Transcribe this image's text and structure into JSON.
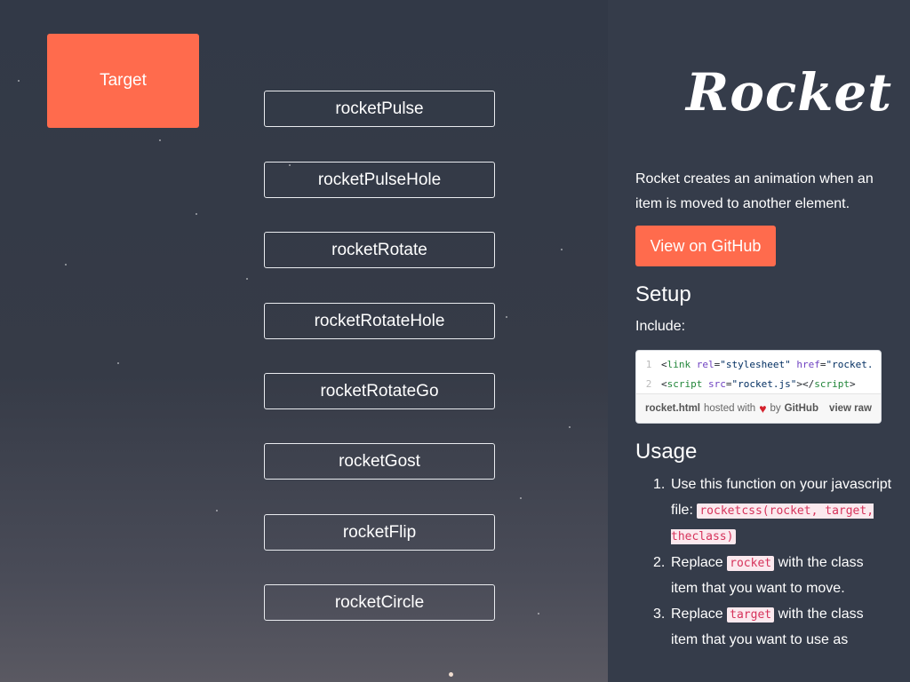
{
  "target": {
    "label": "Target"
  },
  "rocket_buttons": [
    "rocketPulse",
    "rocketPulseHole",
    "rocketRotate",
    "rocketRotateHole",
    "rocketRotateGo",
    "rocketGost",
    "rocketFlip",
    "rocketCircle"
  ],
  "sidebar": {
    "logo": "Rocket",
    "intro": "Rocket creates an animation when an item is moved to another element.",
    "github_button": "View on GitHub",
    "setup_heading": "Setup",
    "include_label": "Include:",
    "gist": {
      "line_numbers": [
        "1",
        "2"
      ],
      "file_name": "rocket.html",
      "hosted_with": "hosted with",
      "by_text": "by",
      "github": "GitHub",
      "view_raw": "view raw"
    },
    "usage_heading": "Usage",
    "usage_items": [
      {
        "num": "1.",
        "text": "Use this function on your javascript file:",
        "code": "rocketcss(rocket, target, theclass)"
      },
      {
        "num": "2.",
        "before": "Replace",
        "code": "rocket",
        "after": "with the class item that you want to move."
      },
      {
        "num": "3.",
        "before": "Replace",
        "code": "target",
        "after": "with the class item that you want to use as"
      }
    ]
  },
  "colors": {
    "accent": "#ff6b4d",
    "sidebar_bg": "#353c4a",
    "code_pink": "#d6335b"
  }
}
